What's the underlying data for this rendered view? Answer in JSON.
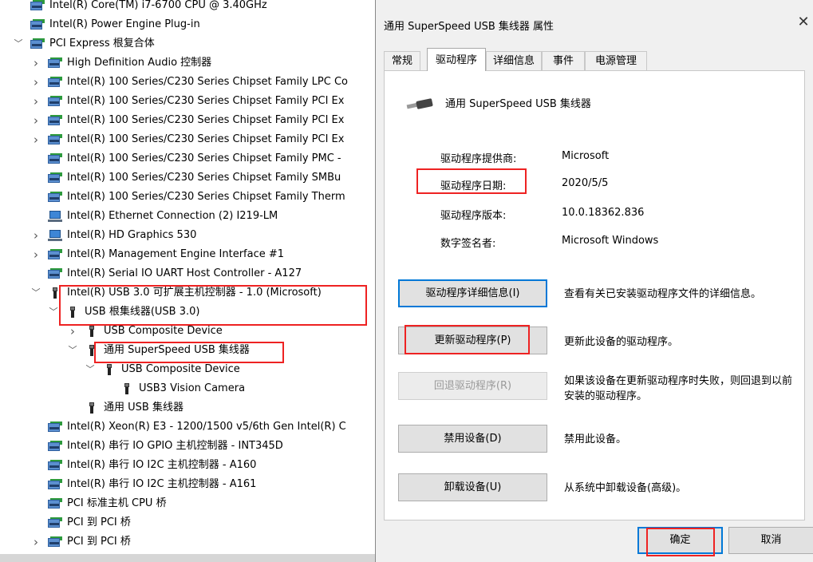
{
  "tree": {
    "rows": [
      {
        "label": "Intel(R) Core(TM) i7-6700 CPU @ 3.40GHz",
        "icon": "cpu-icon",
        "indent": 1
      },
      {
        "label": "Intel(R) Power Engine Plug-in",
        "icon": "device-icon",
        "indent": 1
      },
      {
        "label": "PCI Express 根复合体",
        "icon": "device-icon",
        "indent": 1,
        "chevron": "expanded"
      },
      {
        "label": "High Definition Audio 控制器",
        "icon": "device-icon",
        "indent": 2,
        "chevron": "collapsed"
      },
      {
        "label": "Intel(R) 100 Series/C230 Series Chipset Family LPC Co",
        "icon": "device-icon",
        "indent": 2,
        "chevron": "collapsed"
      },
      {
        "label": "Intel(R) 100 Series/C230 Series Chipset Family PCI Ex",
        "icon": "device-icon",
        "indent": 2,
        "chevron": "collapsed"
      },
      {
        "label": "Intel(R) 100 Series/C230 Series Chipset Family PCI Ex",
        "icon": "device-icon",
        "indent": 2,
        "chevron": "collapsed"
      },
      {
        "label": "Intel(R) 100 Series/C230 Series Chipset Family PCI Ex",
        "icon": "device-icon",
        "indent": 2,
        "chevron": "collapsed"
      },
      {
        "label": "Intel(R) 100 Series/C230 Series Chipset Family PMC -",
        "icon": "device-icon",
        "indent": 2
      },
      {
        "label": "Intel(R) 100 Series/C230 Series Chipset Family SMBu",
        "icon": "device-icon",
        "indent": 2
      },
      {
        "label": "Intel(R) 100 Series/C230 Series Chipset Family Therm",
        "icon": "device-icon",
        "indent": 2
      },
      {
        "label": "Intel(R) Ethernet Connection (2) I219-LM",
        "icon": "network-icon",
        "indent": 2
      },
      {
        "label": "Intel(R) HD Graphics 530",
        "icon": "display-icon",
        "indent": 2,
        "chevron": "collapsed"
      },
      {
        "label": "Intel(R) Management Engine Interface #1",
        "icon": "device-icon",
        "indent": 2,
        "chevron": "collapsed"
      },
      {
        "label": "Intel(R) Serial IO UART Host Controller - A127",
        "icon": "device-icon",
        "indent": 2
      },
      {
        "label": "Intel(R) USB 3.0 可扩展主机控制器 - 1.0 (Microsoft)",
        "icon": "usb-icon",
        "indent": 2,
        "chevron": "expanded"
      },
      {
        "label": "USB 根集线器(USB 3.0)",
        "icon": "usb-icon",
        "indent": 3,
        "chevron": "expanded"
      },
      {
        "label": "USB Composite Device",
        "icon": "usb-icon",
        "indent": 4,
        "chevron": "collapsed"
      },
      {
        "label": "通用 SuperSpeed USB 集线器",
        "icon": "usb-icon",
        "indent": 4,
        "chevron": "expanded",
        "selected": true
      },
      {
        "label": "USB Composite Device",
        "icon": "usb-icon",
        "indent": 5,
        "chevron": "expanded"
      },
      {
        "label": "USB3 Vision Camera",
        "icon": "usb-icon",
        "indent": 6
      },
      {
        "label": "通用 USB 集线器",
        "icon": "usb-icon",
        "indent": 4
      },
      {
        "label": "Intel(R) Xeon(R) E3 - 1200/1500 v5/6th Gen Intel(R) C",
        "icon": "device-icon",
        "indent": 2
      },
      {
        "label": "Intel(R) 串行 IO GPIO 主机控制器 - INT345D",
        "icon": "device-icon",
        "indent": 2
      },
      {
        "label": "Intel(R) 串行 IO I2C 主机控制器 - A160",
        "icon": "device-icon",
        "indent": 2
      },
      {
        "label": "Intel(R) 串行 IO I2C 主机控制器 - A161",
        "icon": "device-icon",
        "indent": 2
      },
      {
        "label": "PCI 标准主机 CPU 桥",
        "icon": "device-icon",
        "indent": 2
      },
      {
        "label": "PCI 到 PCI 桥",
        "icon": "device-icon",
        "indent": 2
      },
      {
        "label": "PCI 到 PCI 桥",
        "icon": "device-icon",
        "indent": 2,
        "chevron": "collapsed"
      }
    ]
  },
  "dialog": {
    "title": "通用 SuperSpeed USB 集线器 属性",
    "close_glyph": "✕",
    "tabs": [
      {
        "label": "常规"
      },
      {
        "label": "驱动程序",
        "active": true
      },
      {
        "label": "详细信息"
      },
      {
        "label": "事件"
      },
      {
        "label": "电源管理"
      }
    ],
    "device_name": "通用 SuperSpeed USB 集线器",
    "properties": [
      {
        "label": "驱动程序提供商:",
        "value": "Microsoft"
      },
      {
        "label": "驱动程序日期:",
        "value": "2020/5/5"
      },
      {
        "label": "驱动程序版本:",
        "value": "10.0.18362.836"
      },
      {
        "label": "数字签名者:",
        "value": "Microsoft Windows"
      }
    ],
    "actions": [
      {
        "label": "驱动程序详细信息(I)",
        "desc": "查看有关已安装驱动程序文件的详细信息。"
      },
      {
        "label": "更新驱动程序(P)",
        "desc": "更新此设备的驱动程序。"
      },
      {
        "label": "回退驱动程序(R)",
        "desc": "如果该设备在更新驱动程序时失败，则回退到以前安装的驱动程序。",
        "disabled": true
      },
      {
        "label": "禁用设备(D)",
        "desc": "禁用此设备。"
      },
      {
        "label": "卸载设备(U)",
        "desc": "从系统中卸载设备(高级)。"
      }
    ],
    "ok_label": "确定",
    "cancel_label": "取消"
  },
  "colors": {
    "highlight": "#e22222",
    "focus": "#0078d7"
  }
}
